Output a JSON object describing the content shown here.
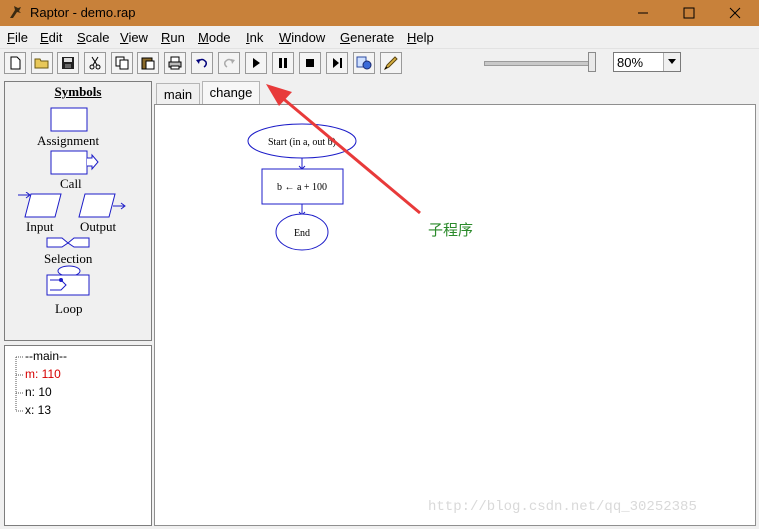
{
  "window": {
    "title": "Raptor - demo.rap"
  },
  "menu": [
    {
      "label": "File",
      "key": "F",
      "rest": "ile"
    },
    {
      "label": "Edit",
      "key": "E",
      "rest": "dit"
    },
    {
      "label": "Scale",
      "key": "S",
      "rest": "cale"
    },
    {
      "label": "View",
      "key": "V",
      "rest": "iew"
    },
    {
      "label": "Run",
      "key": "R",
      "rest": "un"
    },
    {
      "label": "Mode",
      "key": "M",
      "rest": "ode"
    },
    {
      "label": "Ink",
      "key": "I",
      "rest": "nk"
    },
    {
      "label": "Window",
      "key": "W",
      "rest": "indow"
    },
    {
      "label": "Generate",
      "key": "G",
      "rest": "enerate"
    },
    {
      "label": "Help",
      "key": "H",
      "rest": "elp"
    }
  ],
  "toolbar": {
    "icons": [
      "new-file-icon",
      "open-folder-icon",
      "save-icon",
      "cut-icon",
      "copy-icon",
      "paste-icon",
      "print-icon",
      "undo-icon",
      "redo-icon",
      "play-icon",
      "pause-icon",
      "stop-icon",
      "step-icon",
      "test-server-icon",
      "pen-icon"
    ],
    "zoom_level": 1.0,
    "zoom_value": "80%"
  },
  "symbols": {
    "title": "Symbols",
    "assignment": "Assignment",
    "call": "Call",
    "input": "Input",
    "output": "Output",
    "selection": "Selection",
    "loop": "Loop"
  },
  "variables": {
    "items": [
      {
        "text": "--main--",
        "color": "#000000"
      },
      {
        "text": "m: 110",
        "color": "#d60000"
      },
      {
        "text": "n: 10",
        "color": "#000000"
      },
      {
        "text": "x: 13",
        "color": "#000000"
      }
    ]
  },
  "tabs": [
    {
      "label": "main",
      "active": false
    },
    {
      "label": "change",
      "active": true
    }
  ],
  "flowchart": {
    "start": "Start (in a, out b)",
    "assign": "b ← a + 100",
    "end": "End"
  },
  "annotation": {
    "text": "子程序",
    "arrow_color": "#e83a3a"
  },
  "watermark": "http://blog.csdn.net/qq_30252385",
  "colors": {
    "titlebar": "#c8813a",
    "flow_stroke": "#1c1cc8"
  }
}
